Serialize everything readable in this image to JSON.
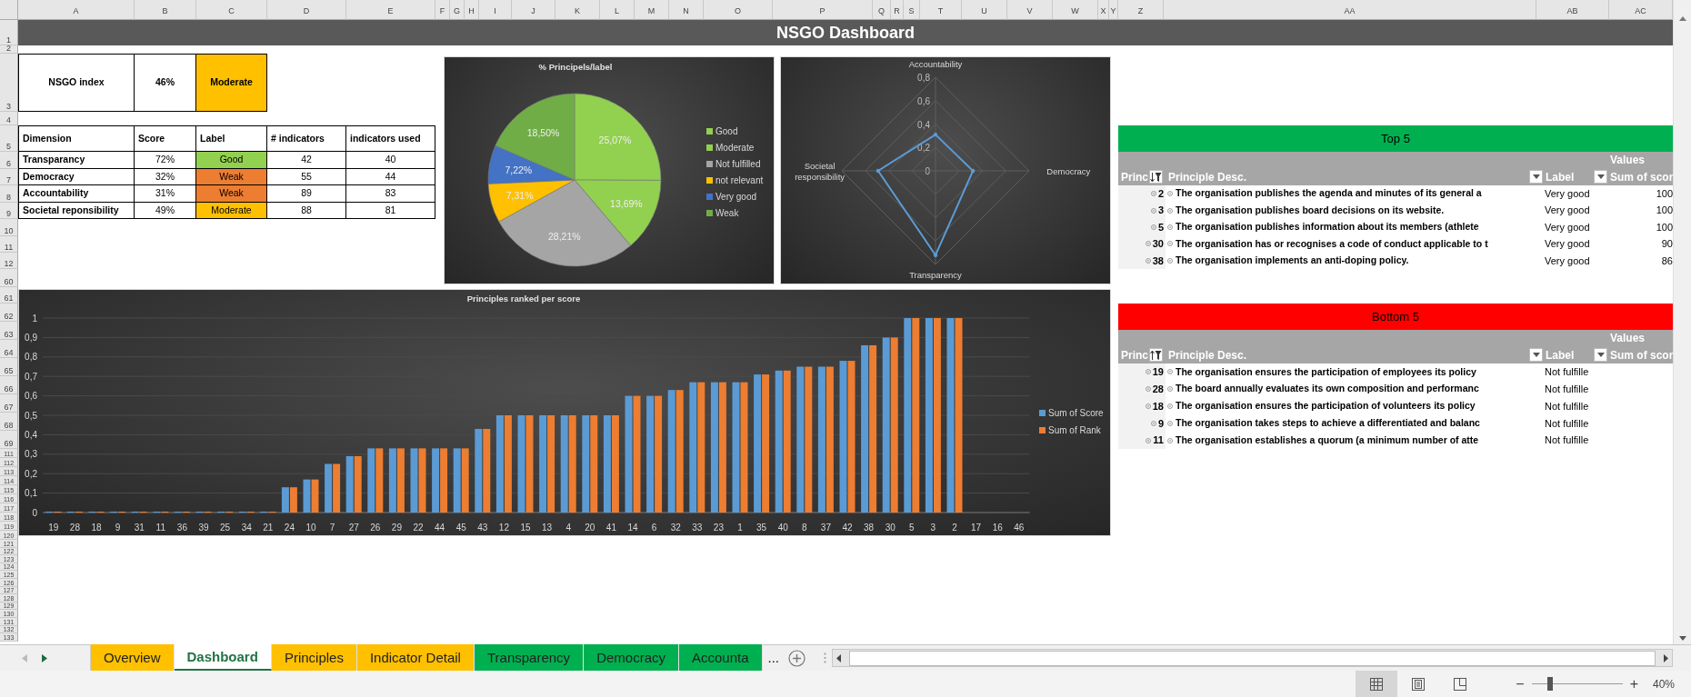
{
  "columns": [
    "A",
    "B",
    "C",
    "D",
    "E",
    "F",
    "G",
    "H",
    "I",
    "J",
    "K",
    "L",
    "M",
    "N",
    "O",
    "P",
    "Q",
    "R",
    "S",
    "T",
    "U",
    "V",
    "W",
    "X",
    "Y",
    "Z",
    "AA",
    "AB",
    "AC"
  ],
  "rows": [
    "1",
    "2",
    "3",
    "4",
    "5",
    "6",
    "7",
    "8",
    "9",
    "10",
    "11",
    "12",
    "60",
    "61",
    "62",
    "63",
    "64",
    "65",
    "66",
    "67",
    "68",
    "69",
    "111",
    "112",
    "113",
    "114",
    "115",
    "116",
    "117",
    "118",
    "119",
    "120",
    "121",
    "122",
    "123",
    "124",
    "125",
    "126",
    "127",
    "128",
    "129",
    "130",
    "131",
    "132",
    "133"
  ],
  "title": "NSGO Dashboard",
  "index_box": {
    "label": "NSGO index",
    "score": "46%",
    "rating": "Moderate",
    "color": "#ffc000"
  },
  "dimensions": {
    "columns": [
      "Dimension",
      "Score",
      "Label",
      "# indicators",
      "indicators used"
    ],
    "rows": [
      {
        "dimension": "Transparancy",
        "score": "72%",
        "label": "Good",
        "color": "#92d050",
        "indicators": "42",
        "used": "40"
      },
      {
        "dimension": "Democracy",
        "score": "32%",
        "label": "Weak",
        "color": "#ed7d31",
        "indicators": "55",
        "used": "44"
      },
      {
        "dimension": "Accountability",
        "score": "31%",
        "label": "Weak",
        "color": "#ed7d31",
        "indicators": "89",
        "used": "83"
      },
      {
        "dimension": "Societal reponsibility",
        "score": "49%",
        "label": "Moderate",
        "color": "#ffc000",
        "indicators": "88",
        "used": "81"
      }
    ]
  },
  "pie": {
    "chart_data": {
      "type": "pie",
      "title": "% Principels/label",
      "categories": [
        "Good",
        "Moderate",
        "Not fulfilled",
        "not relevant",
        "Very good",
        "Weak"
      ],
      "colors": [
        "#92d050",
        "#92d050",
        "#a5a5a5",
        "#ffc000",
        "#4472c4",
        "#70ad47"
      ],
      "values": [
        25.07,
        13.69,
        28.21,
        7.31,
        7.22,
        18.5
      ],
      "legend": "right",
      "value_labels": [
        "25,07%",
        "13,69%",
        "28,21%",
        "7,31%",
        "7,22%",
        "18,50%"
      ]
    }
  },
  "radar": {
    "chart_data": {
      "type": "radar",
      "categories": [
        "Accountability",
        "Democracy",
        "Transparency",
        "Societal responsibility"
      ],
      "series": [
        {
          "color": "#5b9bd5",
          "values": [
            0.31,
            0.32,
            0.72,
            0.49
          ]
        }
      ],
      "grid": true,
      "ylim": [
        0,
        0.8
      ],
      "yticks": [
        0,
        {
          "value": 0.2,
          "label": "0,2"
        },
        {
          "value": 0.4,
          "label": "0,4"
        },
        {
          "value": 0.6,
          "label": "0,6"
        },
        {
          "value": 0.8,
          "label": "0,8"
        }
      ]
    }
  },
  "bar_chart": {
    "chart_data": {
      "type": "bar",
      "title": "Principles ranked per score",
      "categories": [
        "19",
        "28",
        "18",
        "9",
        "31",
        "11",
        "36",
        "39",
        "25",
        "34",
        "21",
        "24",
        "10",
        "7",
        "27",
        "26",
        "29",
        "22",
        "44",
        "45",
        "43",
        "12",
        "15",
        "13",
        "4",
        "20",
        "41",
        "14",
        "6",
        "32",
        "33",
        "23",
        "1",
        "35",
        "40",
        "8",
        "37",
        "42",
        "38",
        "30",
        "5",
        "3",
        "2",
        "17",
        "16",
        "46"
      ],
      "series": [
        {
          "name": "Sum of Score",
          "color": "#5b9bd5",
          "values": [
            0,
            0,
            0,
            0,
            0,
            0,
            0,
            0,
            0,
            0,
            0,
            0.13,
            0.17,
            0.25,
            0.29,
            0.33,
            0.33,
            0.33,
            0.33,
            0.33,
            0.43,
            0.5,
            0.5,
            0.5,
            0.5,
            0.5,
            0.5,
            0.6,
            0.6,
            0.63,
            0.67,
            0.67,
            0.67,
            0.71,
            0.73,
            0.75,
            0.75,
            0.78,
            0.86,
            0.9,
            1,
            1,
            1,
            null,
            null,
            null
          ]
        },
        {
          "name": "Sum of Rank",
          "color": "#ed7d31",
          "values": [
            0,
            0,
            0,
            0,
            0,
            0,
            0,
            0,
            0,
            0,
            0,
            0.13,
            0.17,
            0.25,
            0.29,
            0.33,
            0.33,
            0.33,
            0.33,
            0.33,
            0.43,
            0.5,
            0.5,
            0.5,
            0.5,
            0.5,
            0.5,
            0.6,
            0.6,
            0.63,
            0.67,
            0.67,
            0.67,
            0.71,
            0.73,
            0.75,
            0.75,
            0.78,
            0.86,
            0.9,
            1,
            1,
            1,
            null,
            null,
            null
          ]
        }
      ],
      "ylim": [
        0,
        1
      ],
      "grid": true,
      "legend": "right",
      "yticks": [
        0,
        {
          "value": 0.1,
          "label": "0,1"
        },
        {
          "value": 0.2,
          "label": "0,2"
        },
        {
          "value": 0.3,
          "label": "0,3"
        },
        {
          "value": 0.4,
          "label": "0,4"
        },
        {
          "value": 0.5,
          "label": "0,5"
        },
        {
          "value": 0.6,
          "label": "0,6"
        },
        {
          "value": 0.7,
          "label": "0,7"
        },
        {
          "value": 0.8,
          "label": "0,8"
        },
        {
          "value": 0.9,
          "label": "0,9"
        },
        1
      ]
    }
  },
  "top5": {
    "title": "Top 5",
    "color": "#00b050",
    "sort_descending": true,
    "values_label": "Values",
    "columns": [
      "Princ",
      "Principle Desc.",
      "Label",
      "Sum of scor"
    ],
    "rows": [
      {
        "principle": "2",
        "description": "The organisation publishes the agenda and minutes of its general a",
        "label": "Very good",
        "score": "100"
      },
      {
        "principle": "3",
        "description": "The organisation publishes board decisions on its website.",
        "label": "Very good",
        "score": "100"
      },
      {
        "principle": "5",
        "description": "The organisation publishes information about its members (athlete",
        "label": "Very good",
        "score": "100"
      },
      {
        "principle": "30",
        "description": "The organisation has or recognises a code of conduct applicable to t",
        "label": "Very good",
        "score": "90"
      },
      {
        "principle": "38",
        "description": "The organisation implements an anti-doping policy.",
        "label": "Very good",
        "score": "86"
      }
    ]
  },
  "bottom5": {
    "title": "Bottom 5",
    "color": "#ff0000",
    "sort_descending": false,
    "values_label": "Values",
    "columns": [
      "Princ",
      "Principle Desc.",
      "Label",
      "Sum of scor"
    ],
    "rows": [
      {
        "principle": "19",
        "description": "The organisation ensures the participation of employees its policy",
        "label": "Not fulfille"
      },
      {
        "principle": "28",
        "description": "The board annually evaluates its own composition and performanc",
        "label": "Not fulfille"
      },
      {
        "principle": "18",
        "description": "The organisation ensures the participation of volunteers its policy",
        "label": "Not fulfille"
      },
      {
        "principle": "9",
        "description": "The organisation takes steps to achieve a differentiated and balanc",
        "label": "Not fulfille"
      },
      {
        "principle": "11",
        "description": "The organisation establishes a quorum (a minimum number of atte",
        "label": "Not fulfille"
      }
    ]
  },
  "sheet_tabs": [
    {
      "label": "Overview",
      "color": "#ffc000",
      "selected": false
    },
    {
      "label": "Dashboard",
      "selected": true
    },
    {
      "label": "Principles",
      "color": "#ffc000",
      "selected": false
    },
    {
      "label": "Indicator Detail",
      "color": "#ffc000",
      "selected": false
    },
    {
      "label": "Transparency",
      "color": "#00b050",
      "selected": false
    },
    {
      "label": "Democracy",
      "color": "#00b050",
      "selected": false
    },
    {
      "label": "Accounta",
      "color": "#00b050",
      "selected": false
    }
  ],
  "tab_overflow": "...",
  "status_bar": {
    "views": [
      {
        "kind": "normal",
        "selected": true
      },
      {
        "kind": "page-layout",
        "selected": false
      },
      {
        "kind": "page-break",
        "selected": false
      }
    ],
    "zoom_out": "−",
    "zoom_slider": {
      "level": 0.2
    },
    "zoom_in": "+",
    "zoom": "40%"
  }
}
